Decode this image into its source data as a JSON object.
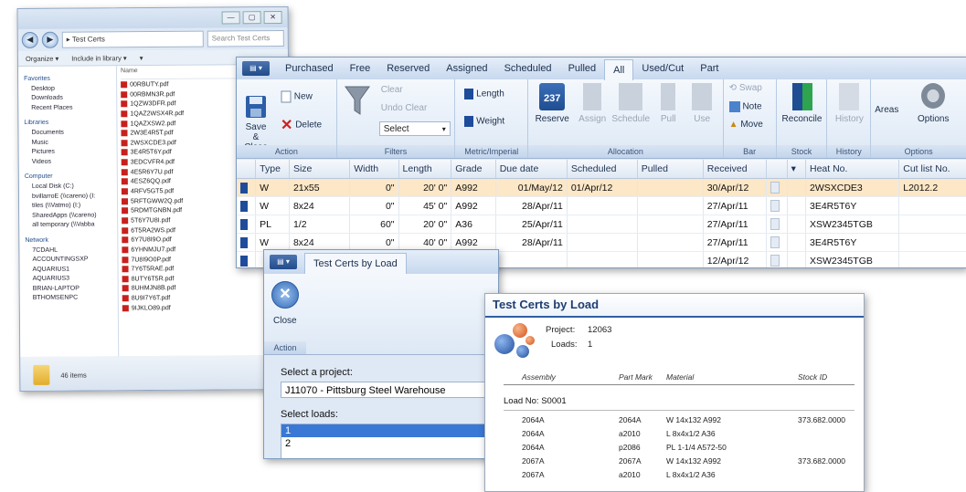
{
  "explorer": {
    "titlebar_buttons": [
      "—",
      "▢",
      "✕"
    ],
    "address": "▸ Test Certs",
    "search_placeholder": "Search Test Certs",
    "commands": [
      "Organize ▾",
      "Include in library ▾",
      "▾"
    ],
    "nav_items": [
      {
        "label": "Favorites",
        "group": true
      },
      {
        "label": "Desktop"
      },
      {
        "label": "Downloads"
      },
      {
        "label": "Recent Places"
      },
      {
        "label": "Libraries",
        "group": true
      },
      {
        "label": "Documents"
      },
      {
        "label": "Music"
      },
      {
        "label": "Pictures"
      },
      {
        "label": "Videos"
      },
      {
        "label": "Computer",
        "group": true
      },
      {
        "label": "Local Disk (C:)"
      },
      {
        "label": "bvillarroE (\\\\careno) (I:"
      },
      {
        "label": "tiles (\\\\Vatmo) (I:)"
      },
      {
        "label": "SharedApps (\\\\careno)"
      },
      {
        "label": "all temporary (\\\\Vabba"
      },
      {
        "label": "Network",
        "group": true
      },
      {
        "label": "7CDAHL"
      },
      {
        "label": "ACCOUNTINGSXP"
      },
      {
        "label": "AQUARIUS1"
      },
      {
        "label": "AQUARIUS3"
      },
      {
        "label": "BRIAN-LAPTOP"
      },
      {
        "label": "BTHOMSENPC"
      }
    ],
    "files_header": "Name",
    "files": [
      "00RBUTY.pdf",
      "00RBMN3R.pdf",
      "1QZW3DFR.pdf",
      "1QAZ2WSX4R.pdf",
      "1QAZXSW2.pdf",
      "2W3E4R5T.pdf",
      "2WSXCDE3.pdf",
      "3E4R5T6Y.pdf",
      "3EDCVFR4.pdf",
      "4E5R6Y7U.pdf",
      "4ESZ6QQ.pdf",
      "4RFV5GT5.pdf",
      "5RFTGWW2Q.pdf",
      "5RDMTGNBN.pdf",
      "5T6Y7U8I.pdf",
      "6T5RA2WS.pdf",
      "6Y7U8I9O.pdf",
      "6YHNMJU7.pdf",
      "7U8I9O0P.pdf",
      "7Y6T5RAE.pdf",
      "8UTY6T5R.pdf",
      "8UHMJN8B.pdf",
      "8U9I7Y6T.pdf",
      "9IJKLO89.pdf"
    ],
    "status": "46 items"
  },
  "main": {
    "app_menu": "▤ ▾",
    "tabs": [
      "Purchased",
      "Free",
      "Reserved",
      "Assigned",
      "Scheduled",
      "Pulled",
      "All",
      "Used/Cut",
      "Part"
    ],
    "active_tab": "All",
    "ribbon": {
      "save_close": "Save &\nClose",
      "new": "New",
      "delete": "Delete",
      "clear": "Clear",
      "undo_clear": "Undo Clear",
      "select": "Select",
      "length": "Length",
      "weight": "Weight",
      "reserve": "Reserve",
      "reserve_badge": "237",
      "assign": "Assign",
      "schedule": "Schedule",
      "pull": "Pull",
      "use": "Use",
      "swap": "Swap",
      "note": "Note",
      "move": "Move",
      "reconcile": "Reconcile",
      "history": "History",
      "areas": "Areas",
      "options": "Options",
      "groups": [
        "Action",
        "Filters",
        "Metric/Imperial",
        "Allocation",
        "Bar",
        "Stock",
        "History",
        "Options"
      ]
    },
    "grid": {
      "columns": [
        "",
        "Type",
        "Size",
        "Width",
        "Length",
        "Grade",
        "Due date",
        "Scheduled",
        "Pulled",
        "Received",
        "",
        "▾",
        "Heat No.",
        "Cut list No."
      ],
      "rows": [
        {
          "type": "W",
          "size": "21x55",
          "width": "0\"",
          "length": "20' 0\"",
          "grade": "A992",
          "due": "01/May/12",
          "scheduled": "01/Apr/12",
          "pulled": "",
          "received": "30/Apr/12",
          "heat": "2WSXCDE3",
          "cutlist": "L2012.2",
          "highlight": true
        },
        {
          "type": "W",
          "size": "8x24",
          "width": "0\"",
          "length": "45' 0\"",
          "grade": "A992",
          "due": "28/Apr/11",
          "scheduled": "",
          "pulled": "",
          "received": "27/Apr/11",
          "heat": "3E4R5T6Y",
          "cutlist": ""
        },
        {
          "type": "PL",
          "size": "1/2",
          "width": "60\"",
          "length": "20' 0\"",
          "grade": "A36",
          "due": "25/Apr/11",
          "scheduled": "",
          "pulled": "",
          "received": "27/Apr/11",
          "heat": "XSW2345TGB",
          "cutlist": ""
        },
        {
          "type": "W",
          "size": "8x24",
          "width": "0\"",
          "length": "40' 0\"",
          "grade": "A992",
          "due": "28/Apr/11",
          "scheduled": "",
          "pulled": "",
          "received": "27/Apr/11",
          "heat": "3E4R5T6Y",
          "cutlist": ""
        },
        {
          "type": "",
          "size": "",
          "width": "",
          "length": "",
          "grade": "",
          "due": "",
          "scheduled": "",
          "pulled": "",
          "received": "12/Apr/12",
          "heat": "XSW2345TGB",
          "cutlist": ""
        }
      ]
    }
  },
  "dialog": {
    "app_menu": "▤ ▾",
    "tab": "Test Certs by Load",
    "close": "Close",
    "group": "Action",
    "project_label": "Select a project:",
    "project_value": "J11070 - Pittsburg Steel Warehouse",
    "loads_label": "Select loads:",
    "loads": [
      "1",
      "2"
    ]
  },
  "report": {
    "title": "Test Certs by Load",
    "project_label": "Project:",
    "project_value": "12063",
    "loads_label": "Loads:",
    "loads_value": "1",
    "columns": [
      "Assembly",
      "Part Mark",
      "Material",
      "Stock ID"
    ],
    "load_label": "Load No: S0001",
    "rows": [
      {
        "assembly": "2064A",
        "part": "2064A",
        "material": "W 14x132  A992",
        "stock": "373.682.0000"
      },
      {
        "assembly": "2064A",
        "part": "a2010",
        "material": "L 8x4x1/2  A36",
        "stock": ""
      },
      {
        "assembly": "2064A",
        "part": "p2086",
        "material": "PL 1-1/4  A572-50",
        "stock": ""
      },
      {
        "assembly": "2067A",
        "part": "2067A",
        "material": "W 14x132  A992",
        "stock": "373.682.0000"
      },
      {
        "assembly": "2067A",
        "part": "a2010",
        "material": "L 8x4x1/2  A36",
        "stock": ""
      }
    ]
  }
}
